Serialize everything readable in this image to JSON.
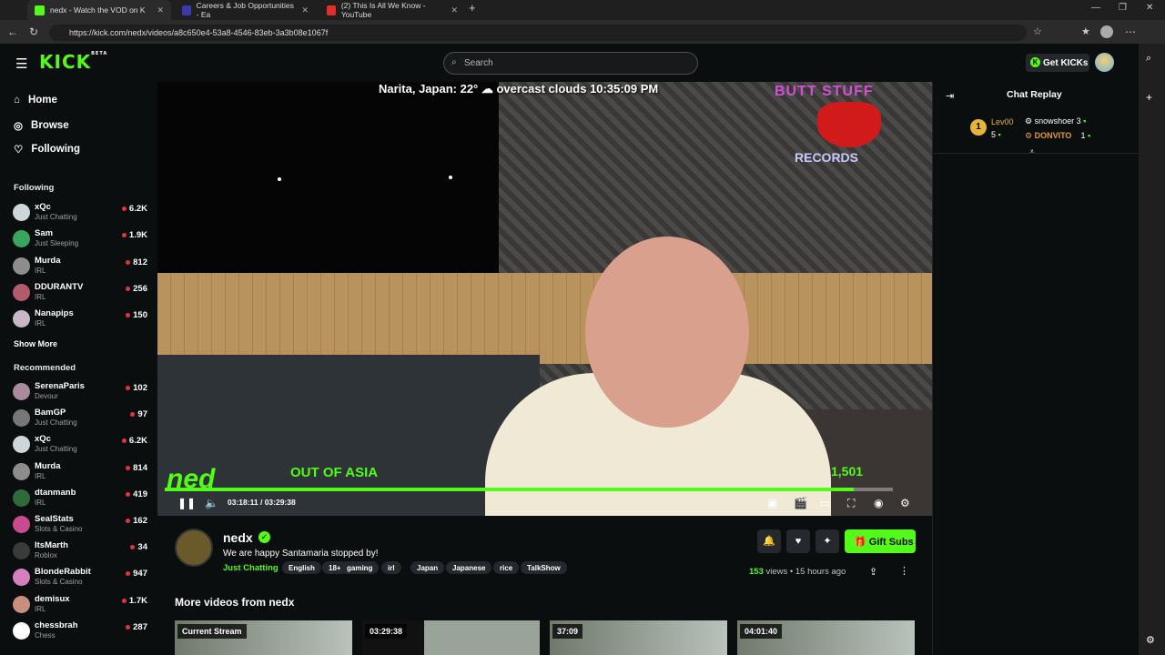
{
  "browser": {
    "tabs": [
      {
        "label": "nedx - Watch the VOD on K",
        "active": true
      },
      {
        "label": "Careers & Job Opportunities - Ea",
        "active": false
      },
      {
        "label": "(2) This Is All We Know - YouTube",
        "active": false
      }
    ],
    "url": "https://kick.com/nedx/videos/a8c650e4-53a8-4546-83eb-3a3b08e1067f"
  },
  "header": {
    "logo": "KICK",
    "logo_badge": "BETA",
    "search_placeholder": "Search",
    "get_kicks_label": "Get KICKs"
  },
  "sidebar": {
    "nav": [
      {
        "label": "Home",
        "icon": "home-icon"
      },
      {
        "label": "Browse",
        "icon": "compass-icon"
      },
      {
        "label": "Following",
        "icon": "heart-icon"
      }
    ],
    "following_heading": "Following",
    "following": [
      {
        "name": "xQc",
        "category": "Just Chatting",
        "viewers": "6.2K",
        "color": "#cfd6d9"
      },
      {
        "name": "Sam",
        "category": "Just Sleeping",
        "viewers": "1.9K",
        "color": "#3aa55c"
      },
      {
        "name": "Murda",
        "category": "IRL",
        "viewers": "812",
        "color": "#8d8d8d"
      },
      {
        "name": "DDURANTV",
        "category": "IRL",
        "viewers": "256",
        "color": "#b35a6d"
      },
      {
        "name": "Nanapips",
        "category": "IRL",
        "viewers": "150",
        "color": "#c9b6c9"
      }
    ],
    "show_more": "Show More",
    "recommended_heading": "Recommended",
    "recommended": [
      {
        "name": "SerenaParis",
        "category": "Devour",
        "viewers": "102",
        "color": "#a98b9d"
      },
      {
        "name": "BamGP",
        "category": "Just Chatting",
        "viewers": "97",
        "color": "#777"
      },
      {
        "name": "xQc",
        "category": "Just Chatting",
        "viewers": "6.2K",
        "color": "#cfd6d9"
      },
      {
        "name": "Murda",
        "category": "IRL",
        "viewers": "814",
        "color": "#8d8d8d"
      },
      {
        "name": "dtanmanb",
        "category": "IRL",
        "viewers": "419",
        "color": "#2f6b3a"
      },
      {
        "name": "SealStats",
        "category": "Slots & Casino",
        "viewers": "162",
        "color": "#c94a8f"
      },
      {
        "name": "ItsMarth",
        "category": "Roblox",
        "viewers": "34",
        "color": "#3a3a3a"
      },
      {
        "name": "BlondeRabbit",
        "category": "Slots & Casino",
        "viewers": "947",
        "color": "#d77fbe"
      },
      {
        "name": "demisux",
        "category": "IRL",
        "viewers": "1.7K",
        "color": "#c78f7c"
      },
      {
        "name": "chessbrah",
        "category": "Chess",
        "viewers": "287",
        "color": "#ffffff"
      }
    ]
  },
  "video": {
    "overlay_top": "Narita, Japan: 22° ☁ overcast clouds 10:35:09 PM",
    "overlay_brand_top": "BUTT STUFF",
    "overlay_brand_bottom": "RECORDS",
    "overlay_logo": "ned",
    "overlay_location": "OUT OF ASIA",
    "overlay_viewers": "1,501",
    "current_time": "03:18:11",
    "separator": "/",
    "duration": "03:29:38",
    "progress": 0.946
  },
  "channel": {
    "name": "nedx",
    "title": "We are happy Santamaria stopped by!",
    "category": "Just Chatting",
    "tags": [
      "English",
      "18+",
      "gaming",
      "irl",
      "Japan",
      "Japanese",
      "rice",
      "TalkShow"
    ],
    "views_count": "153",
    "views_label": "views",
    "time_ago": "15 hours ago",
    "gift_subs_label": "Gift Subs"
  },
  "more_videos": {
    "heading": "More videos from nedx",
    "items": [
      {
        "label": "Current Stream"
      },
      {
        "label": "03:29:38"
      },
      {
        "label": "37:09"
      },
      {
        "label": "04:01:40"
      }
    ]
  },
  "chat": {
    "title": "Chat Replay",
    "top_gifter": {
      "rank": "1",
      "name": "Lev00",
      "count": "5"
    },
    "gifters": [
      {
        "name": "snowshoer",
        "count": "3"
      },
      {
        "name": "DONVITO",
        "count": "1"
      }
    ]
  },
  "colors": {
    "accent": "#53fc18",
    "background": "#0b0e0f"
  }
}
